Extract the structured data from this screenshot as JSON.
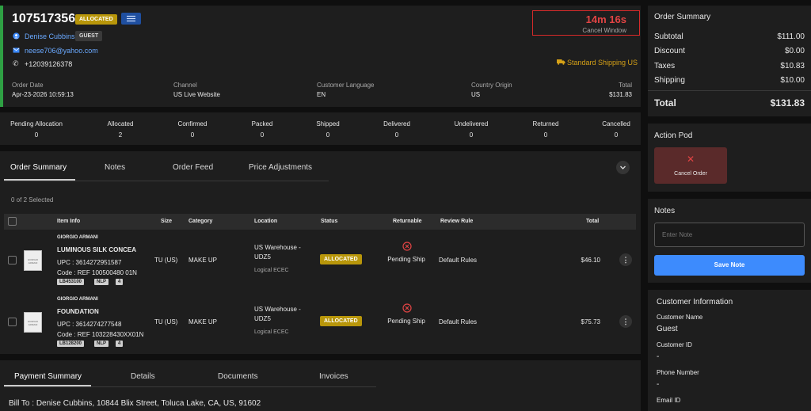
{
  "order": {
    "number": "107517356",
    "status_badge": "ALLOCATED",
    "customer_name": "Denise Cubbins",
    "customer_type": "GUEST",
    "email": "neese706@yahoo.com",
    "phone": "+12039126378",
    "shipping_method": "Standard Shipping US",
    "timer": "14m 16s",
    "timer_caption": "Cancel Window",
    "accent_color": "#2ea043",
    "fields": [
      {
        "label": "Order Date",
        "value": "Apr-23-2026 10:59:13"
      },
      {
        "label": "Channel",
        "value": "US Live Website"
      },
      {
        "label": "Customer Language",
        "value": "EN"
      },
      {
        "label": "Country Origin",
        "value": "US"
      },
      {
        "label": "Total",
        "value": "$131.83"
      }
    ]
  },
  "status_counts": [
    {
      "label": "Pending Allocation",
      "value": "0"
    },
    {
      "label": "Allocated",
      "value": "2"
    },
    {
      "label": "Confirmed",
      "value": "0"
    },
    {
      "label": "Packed",
      "value": "0"
    },
    {
      "label": "Shipped",
      "value": "0"
    },
    {
      "label": "Delivered",
      "value": "0"
    },
    {
      "label": "Undelivered",
      "value": "0"
    },
    {
      "label": "Returned",
      "value": "0"
    },
    {
      "label": "Cancelled",
      "value": "0"
    }
  ],
  "tabs": [
    "Order Summary",
    "Notes",
    "Order Feed",
    "Price Adjustments"
  ],
  "selection_text": "0 of 2 Selected",
  "table": {
    "headers": [
      "Item Info",
      "Size",
      "Category",
      "Location",
      "Status",
      "Returnable",
      "Review Rule",
      "Total"
    ],
    "rows": [
      {
        "brand": "GIORGIO ARMANI",
        "name": "LUMINOUS SILK CONCEA",
        "upc": "UPC : 3614272951587",
        "code": "Code : REF 100500480 01N",
        "tags": [
          "LB453100",
          "NLP",
          "4"
        ],
        "size": "TU (US)",
        "category": "MAKE UP",
        "location_1": "US Warehouse -",
        "location_2": "UDZ5",
        "location_sub": "Logical ECEC",
        "status": "ALLOCATED",
        "returnable": "Pending Ship",
        "review_rule": "Default Rules",
        "total": "$46.10",
        "thumb_text": "GIORGIO ARMANI"
      },
      {
        "brand": "GIORGIO ARMANI",
        "name": "FOUNDATION",
        "upc": "UPC : 3614274277548",
        "code": "Code : REF 103228430XX01N",
        "tags": [
          "LB128200",
          "NLP",
          "4"
        ],
        "size": "TU (US)",
        "category": "MAKE UP",
        "location_1": "US Warehouse -",
        "location_2": "UDZ5",
        "location_sub": "Logical ECEC",
        "status": "ALLOCATED",
        "returnable": "Pending Ship",
        "review_rule": "Default Rules",
        "total": "$75.73",
        "thumb_text": "GIORGIO ARMANI"
      }
    ]
  },
  "bottom_tabs": [
    "Payment Summary",
    "Details",
    "Documents",
    "Invoices"
  ],
  "bill_to": "Bill To : Denise Cubbins, 10844 Blix Street, Toluca Lake, CA, US, 91602",
  "summary": {
    "title": "Order Summary",
    "rows": [
      {
        "label": "Subtotal",
        "value": "$111.00"
      },
      {
        "label": "Discount",
        "value": "$0.00"
      },
      {
        "label": "Taxes",
        "value": "$10.83"
      },
      {
        "label": "Shipping",
        "value": "$10.00"
      }
    ],
    "total_label": "Total",
    "total_value": "$131.83"
  },
  "action_pod": {
    "title": "Action Pod",
    "cancel_label": "Cancel Order"
  },
  "notes": {
    "title": "Notes",
    "placeholder": "Enter Note",
    "save_label": "Save Note"
  },
  "customer_info": {
    "title": "Customer Information",
    "name_label": "Customer Name",
    "name_value": "Guest",
    "id_label": "Customer ID",
    "id_value": "-",
    "phone_label": "Phone Number",
    "phone_value": "-",
    "email_label": "Email ID"
  }
}
